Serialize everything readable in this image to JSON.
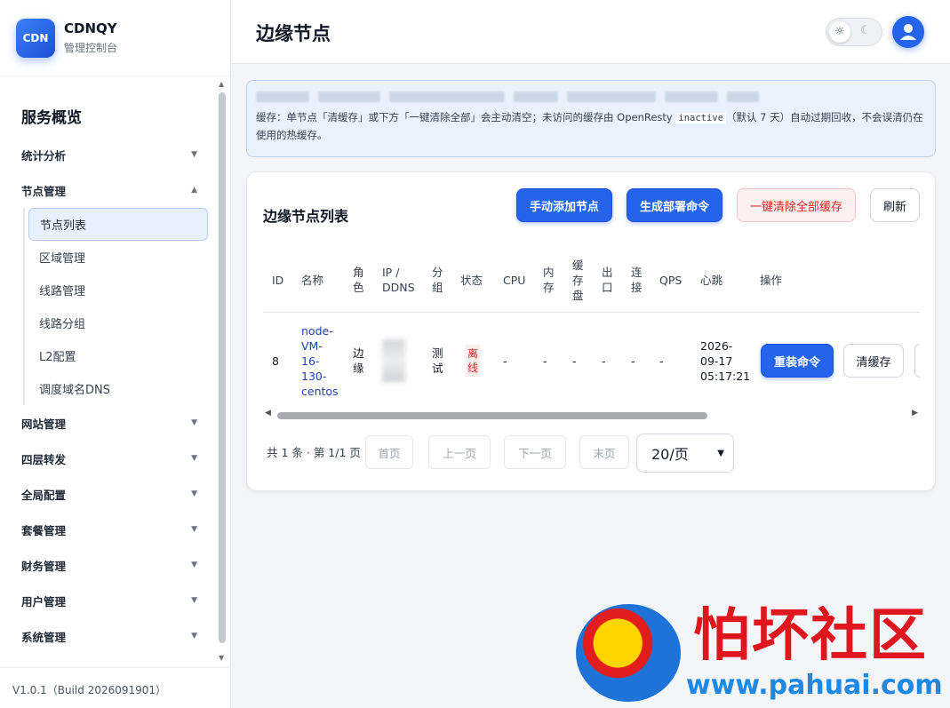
{
  "brand": {
    "logo_text": "CDN",
    "name": "CDNQY",
    "subtitle": "管理控制台"
  },
  "sidebar": {
    "title": "服务概览",
    "groups": [
      {
        "label": "统计分析",
        "expanded": false
      },
      {
        "label": "节点管理",
        "expanded": true,
        "items": [
          {
            "label": "节点列表",
            "active": true
          },
          {
            "label": "区域管理"
          },
          {
            "label": "线路管理"
          },
          {
            "label": "线路分组"
          },
          {
            "label": "L2配置"
          },
          {
            "label": "调度域名DNS"
          }
        ]
      },
      {
        "label": "网站管理",
        "expanded": false
      },
      {
        "label": "四层转发",
        "expanded": false
      },
      {
        "label": "全局配置",
        "expanded": false
      },
      {
        "label": "套餐管理",
        "expanded": false
      },
      {
        "label": "财务管理",
        "expanded": false
      },
      {
        "label": "用户管理",
        "expanded": false
      },
      {
        "label": "系统管理",
        "expanded": false
      }
    ],
    "version": "V1.0.1（Build 2026091901）"
  },
  "header": {
    "title": "边缘节点"
  },
  "info": {
    "text_a": "缓存：单节点「清缓存」或下方「一键清除全部」会主动清空；未访问的缓存由 OpenResty ",
    "code": "inactive",
    "text_b": "（默认 7 天）自动过期回收，不会误清仍在使用的热缓存。"
  },
  "card": {
    "title": "边缘节点列表",
    "buttons": {
      "add_node": "手动添加节点",
      "gen_deploy": "生成部署命令",
      "clear_all": "一键清除全部缓存",
      "refresh": "刷新"
    }
  },
  "table": {
    "headers": {
      "id": "ID",
      "name": "名称",
      "role": "角\n色",
      "ip": "IP /\nDDNS",
      "group": "分\n组",
      "status": "状态",
      "cpu": "CPU",
      "mem": "内\n存",
      "disk": "缓\n存\n盘",
      "egress": "出\n口",
      "conn": "连\n接",
      "qps": "QPS",
      "heartbeat": "心跳",
      "ops": "操作"
    },
    "rows": [
      {
        "id": "8",
        "name": "node-\nVM-\n16-\n130-\ncentos",
        "role": "边\n缘",
        "group": "测\n试",
        "status": "离\n线",
        "cpu": "-",
        "mem": "-",
        "disk": "-",
        "egress": "-",
        "conn": "-",
        "qps": "-",
        "heartbeat": "2026-\n09-17\n05:17:21",
        "reinstall": "重装命令",
        "clear_cache": "清缓存"
      }
    ]
  },
  "pager": {
    "info": "共 1 条 · 第 1/1 页",
    "first": "首页",
    "prev": "上一页",
    "next": "下一页",
    "last": "末页",
    "page_size": "20/页"
  },
  "watermark": {
    "text": "怕坏社区",
    "url": "www.pahuai.com"
  },
  "colors": {
    "accent": "#2563eb",
    "danger": "#dc2626",
    "info_bg": "#e9f2fc"
  }
}
